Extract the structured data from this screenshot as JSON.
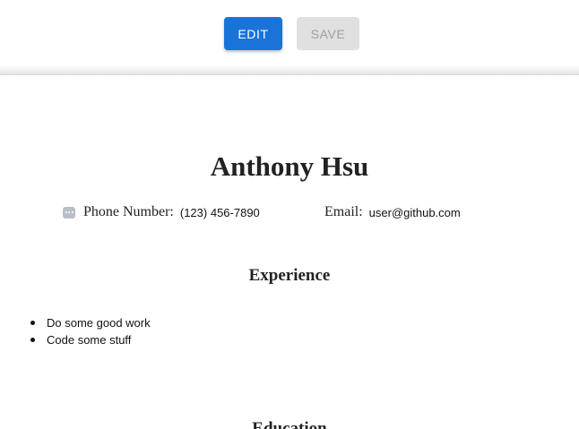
{
  "toolbar": {
    "edit_label": "Edit",
    "save_label": "Save"
  },
  "resume": {
    "name": "Anthony Hsu",
    "contact": {
      "phone_label": "Phone Number:",
      "phone_value": "(123) 456-7890",
      "email_label": "Email:",
      "email_value": "user@github.com"
    },
    "experience": {
      "title": "Experience",
      "items": [
        "Do some good work",
        "Code some stuff"
      ]
    },
    "education": {
      "title": "Education"
    }
  },
  "colors": {
    "primary_button": "#1a73d9",
    "disabled_button": "#e0e0e0",
    "disabled_text": "#9e9e9e",
    "drag_handle": "#b9bec8"
  },
  "icons": {
    "contact_handle": "drag-handle-icon"
  }
}
